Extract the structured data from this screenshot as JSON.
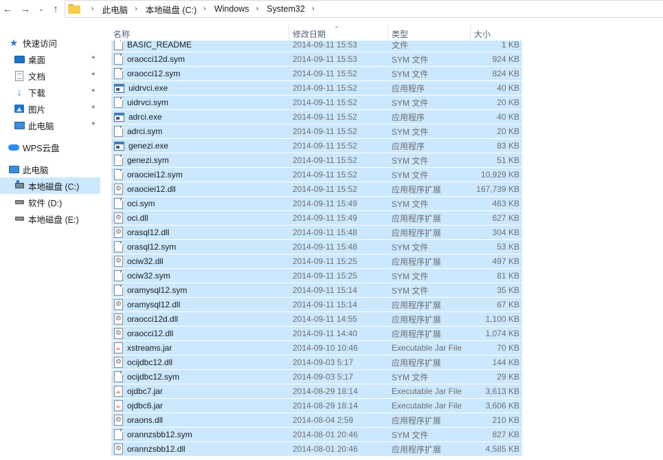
{
  "nav": {
    "back_icon": "←",
    "forward_icon": "→",
    "recent_icon": "⌄",
    "up_icon": "↑",
    "breadcrumb": [
      "此电脑",
      "本地磁盘 (C:)",
      "Windows",
      "System32"
    ],
    "separator": "›"
  },
  "sidebar": {
    "items": [
      {
        "label": "快速访问",
        "icon": "star-icon",
        "pinned": false
      },
      {
        "label": "桌面",
        "icon": "desktop-icon",
        "pinned": true
      },
      {
        "label": "文档",
        "icon": "document-icon",
        "pinned": true
      },
      {
        "label": "下载",
        "icon": "download-icon",
        "pinned": true
      },
      {
        "label": "图片",
        "icon": "pictures-icon",
        "pinned": true
      },
      {
        "label": "此电脑",
        "icon": "computer-icon",
        "pinned": true
      },
      {
        "label": "WPS云盘",
        "icon": "cloud-icon",
        "pinned": false
      },
      {
        "label": "此电脑",
        "icon": "computer-icon",
        "pinned": false
      },
      {
        "label": "本地磁盘 (C:)",
        "icon": "drive-icon",
        "pinned": false,
        "selected": true
      },
      {
        "label": "软件 (D:)",
        "icon": "drive-icon",
        "pinned": false
      },
      {
        "label": "本地磁盘 (E:)",
        "icon": "drive-icon",
        "pinned": false
      }
    ],
    "pin_icon": "📌"
  },
  "columns": {
    "name": "名称",
    "date": "修改日期",
    "type": "类型",
    "size": "大小",
    "sort_icon": "⌃"
  },
  "files": [
    {
      "name": "BASIC_README",
      "date": "2014-09-11 15:53",
      "type": "文件",
      "size": "1 KB",
      "kind": "file"
    },
    {
      "name": "oraocci12d.sym",
      "date": "2014-09-11 15:53",
      "type": "SYM 文件",
      "size": "924 KB",
      "kind": "file"
    },
    {
      "name": "oraocci12.sym",
      "date": "2014-09-11 15:52",
      "type": "SYM 文件",
      "size": "824 KB",
      "kind": "file"
    },
    {
      "name": "uidrvci.exe",
      "date": "2014-09-11 15:52",
      "type": "应用程序",
      "size": "40 KB",
      "kind": "exe"
    },
    {
      "name": "uidrvci.sym",
      "date": "2014-09-11 15:52",
      "type": "SYM 文件",
      "size": "20 KB",
      "kind": "file"
    },
    {
      "name": "adrci.exe",
      "date": "2014-09-11 15:52",
      "type": "应用程序",
      "size": "40 KB",
      "kind": "exe"
    },
    {
      "name": "adrci.sym",
      "date": "2014-09-11 15:52",
      "type": "SYM 文件",
      "size": "20 KB",
      "kind": "file"
    },
    {
      "name": "genezi.exe",
      "date": "2014-09-11 15:52",
      "type": "应用程序",
      "size": "83 KB",
      "kind": "exe"
    },
    {
      "name": "genezi.sym",
      "date": "2014-09-11 15:52",
      "type": "SYM 文件",
      "size": "51 KB",
      "kind": "file"
    },
    {
      "name": "oraociei12.sym",
      "date": "2014-09-11 15:52",
      "type": "SYM 文件",
      "size": "10,929 KB",
      "kind": "file"
    },
    {
      "name": "oraociei12.dll",
      "date": "2014-09-11 15:52",
      "type": "应用程序扩展",
      "size": "167,739 KB",
      "kind": "dll"
    },
    {
      "name": "oci.sym",
      "date": "2014-09-11 15:49",
      "type": "SYM 文件",
      "size": "463 KB",
      "kind": "file"
    },
    {
      "name": "oci.dll",
      "date": "2014-09-11 15:49",
      "type": "应用程序扩展",
      "size": "627 KB",
      "kind": "dll"
    },
    {
      "name": "orasql12.dll",
      "date": "2014-09-11 15:48",
      "type": "应用程序扩展",
      "size": "304 KB",
      "kind": "dll"
    },
    {
      "name": "orasql12.sym",
      "date": "2014-09-11 15:48",
      "type": "SYM 文件",
      "size": "53 KB",
      "kind": "file"
    },
    {
      "name": "ociw32.dll",
      "date": "2014-09-11 15:25",
      "type": "应用程序扩展",
      "size": "497 KB",
      "kind": "dll"
    },
    {
      "name": "ociw32.sym",
      "date": "2014-09-11 15:25",
      "type": "SYM 文件",
      "size": "81 KB",
      "kind": "file"
    },
    {
      "name": "oramysql12.sym",
      "date": "2014-09-11 15:14",
      "type": "SYM 文件",
      "size": "35 KB",
      "kind": "file"
    },
    {
      "name": "oramysql12.dll",
      "date": "2014-09-11 15:14",
      "type": "应用程序扩展",
      "size": "67 KB",
      "kind": "dll"
    },
    {
      "name": "oraocci12d.dll",
      "date": "2014-09-11 14:55",
      "type": "应用程序扩展",
      "size": "1,100 KB",
      "kind": "dll"
    },
    {
      "name": "oraocci12.dll",
      "date": "2014-09-11 14:40",
      "type": "应用程序扩展",
      "size": "1,074 KB",
      "kind": "dll"
    },
    {
      "name": "xstreams.jar",
      "date": "2014-09-10 10:46",
      "type": "Executable Jar File",
      "size": "70 KB",
      "kind": "jar"
    },
    {
      "name": "ocijdbc12.dll",
      "date": "2014-09-03 5:17",
      "type": "应用程序扩展",
      "size": "144 KB",
      "kind": "dll"
    },
    {
      "name": "ocijdbc12.sym",
      "date": "2014-09-03 5:17",
      "type": "SYM 文件",
      "size": "29 KB",
      "kind": "file"
    },
    {
      "name": "ojdbc7.jar",
      "date": "2014-08-29 18:14",
      "type": "Executable Jar File",
      "size": "3,613 KB",
      "kind": "jar"
    },
    {
      "name": "ojdbc6.jar",
      "date": "2014-08-29 18:14",
      "type": "Executable Jar File",
      "size": "3,606 KB",
      "kind": "jar"
    },
    {
      "name": "oraons.dll",
      "date": "2014-08-04 2:59",
      "type": "应用程序扩展",
      "size": "210 KB",
      "kind": "dll"
    },
    {
      "name": "orannzsbb12.sym",
      "date": "2014-08-01 20:46",
      "type": "SYM 文件",
      "size": "827 KB",
      "kind": "file"
    },
    {
      "name": "orannzsbb12.dll",
      "date": "2014-08-01 20:46",
      "type": "应用程序扩展",
      "size": "4,585 KB",
      "kind": "dll"
    }
  ],
  "colors": {
    "selection": "#cce8ff",
    "accent": "#2b7cd3"
  }
}
